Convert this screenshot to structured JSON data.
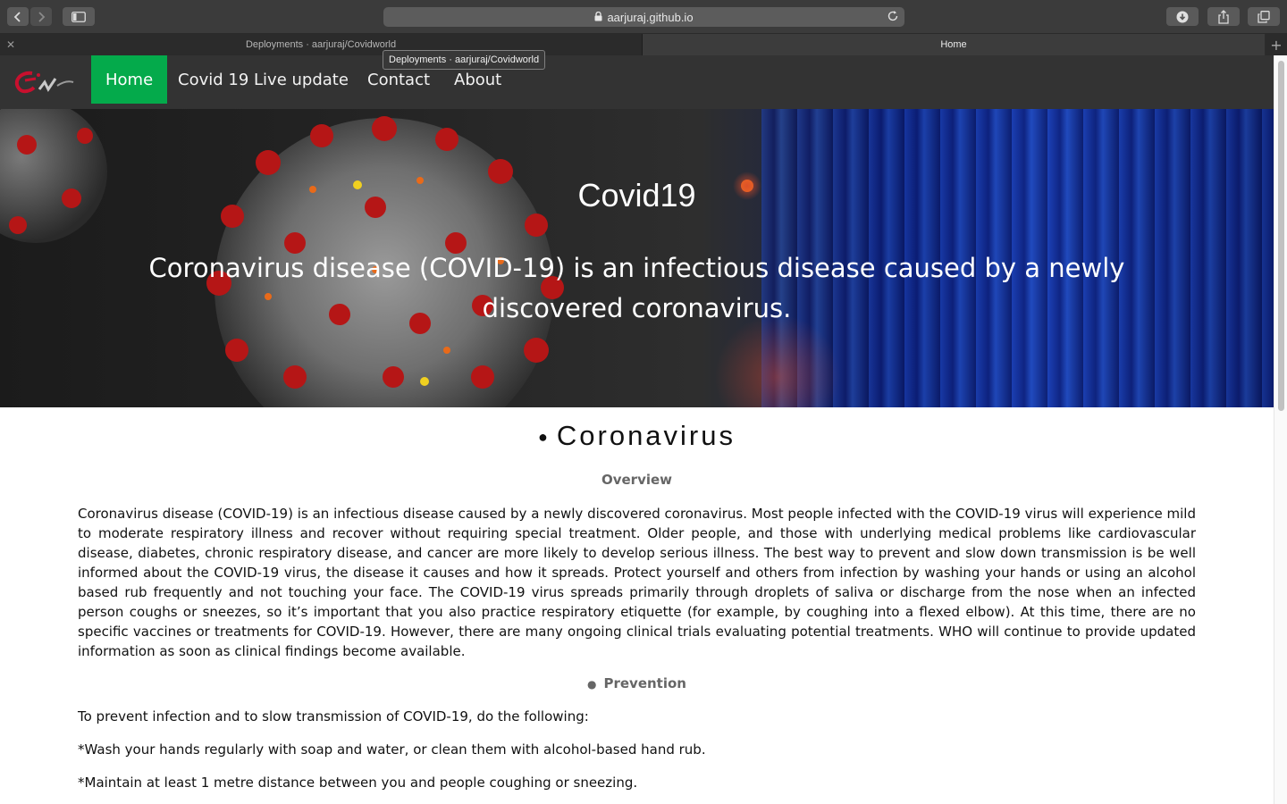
{
  "browser": {
    "url": "aarjuraj.github.io",
    "tabs": [
      {
        "title": "Deployments · aarjuraj/Covidworld",
        "active": false
      },
      {
        "title": "Home",
        "active": true
      }
    ],
    "tooltip": "Deployments · aarjuraj/Covidworld",
    "icons": [
      "back-icon",
      "forward-icon",
      "sidebar-icon",
      "lock-icon",
      "reload-icon",
      "download-icon",
      "share-icon",
      "tabs-overview-icon",
      "close-icon",
      "plus-icon"
    ]
  },
  "nav": {
    "items": [
      {
        "label": "Home",
        "active": true
      },
      {
        "label": "Covid 19 Live update",
        "active": false
      },
      {
        "label": "Contact",
        "active": false
      },
      {
        "label": "About",
        "active": false
      }
    ],
    "active_color": "#04aa4b",
    "bar_color": "#333333"
  },
  "hero": {
    "title": "Covid19",
    "text": "Coronavirus disease (COVID-19) is an infectious disease caused by a newly discovered coronavirus."
  },
  "main": {
    "heading": "Coronavirus",
    "overview_heading": "Overview",
    "overview_text": "Coronavirus disease (COVID-19) is an infectious disease caused by a newly discovered coronavirus. Most people infected with the COVID-19 virus will experience mild to moderate respiratory illness and recover without requiring special treatment. Older people, and those with underlying medical problems like cardiovascular disease, diabetes, chronic respiratory disease, and cancer are more likely to develop serious illness. The best way to prevent and slow down transmission is be well informed about the COVID-19 virus, the disease it causes and how it spreads. Protect yourself and others from infection by washing your hands or using an alcohol based rub frequently and not touching your face. The COVID-19 virus spreads primarily through droplets of saliva or discharge from the nose when an infected person coughs or sneezes, so it’s important that you also practice respiratory etiquette (for example, by coughing into a flexed elbow). At this time, there are no specific vaccines or treatments for COVID-19. However, there are many ongoing clinical trials evaluating potential treatments. WHO will continue to provide updated information as soon as clinical findings become available.",
    "prevention_heading": "Prevention",
    "prevention_intro": "To prevent infection and to slow transmission of COVID-19, do the following:",
    "prevention_items": [
      "*Wash your hands regularly with soap and water, or clean them with alcohol-based hand rub.",
      "*Maintain at least 1 metre distance between you and people coughing or sneezing."
    ]
  }
}
